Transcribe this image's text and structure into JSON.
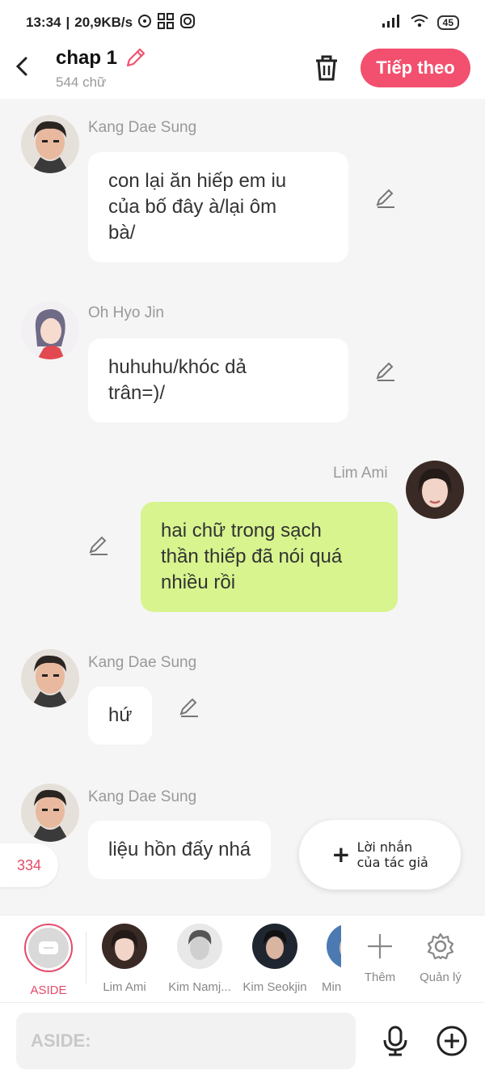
{
  "status": {
    "time": "13:34",
    "speed": "20,9KB/s",
    "battery": "45"
  },
  "header": {
    "title": "chap 1",
    "subtitle": "544 chữ",
    "next_label": "Tiếp theo"
  },
  "messages": [
    {
      "sender": "Kang Dae Sung",
      "text": "con lại ăn hiếp em iu\ncủa bố đây à/lại ôm\nbà/"
    },
    {
      "sender": "Oh Hyo Jin",
      "text": "huhuhu/khóc dả\ntrân=)/"
    },
    {
      "sender": "Lim Ami",
      "text": "hai chữ trong sạch\nthần thiếp đã nói quá\nnhiều rồi"
    },
    {
      "sender": "Kang Dae Sung",
      "text": "hứ"
    },
    {
      "sender": "Kang Dae Sung",
      "text": "liệu hồn đấy nhá"
    }
  ],
  "counter": "334",
  "fab": {
    "line1": "Lời nhắn",
    "line2": "của tác giả"
  },
  "characters": {
    "aside": "ASIDE",
    "c1": "Lim Ami",
    "c2": "Kim Namj...",
    "c3": "Kim Seokjin",
    "c4": "Min",
    "more": "Thêm",
    "manage": "Quản lý"
  },
  "input": {
    "placeholder": "ASIDE:"
  },
  "colors": {
    "accent": "#f2506e",
    "bubble_right": "#d7f48e",
    "bubble_left": "#ffffff",
    "background": "#f5f5f5"
  }
}
